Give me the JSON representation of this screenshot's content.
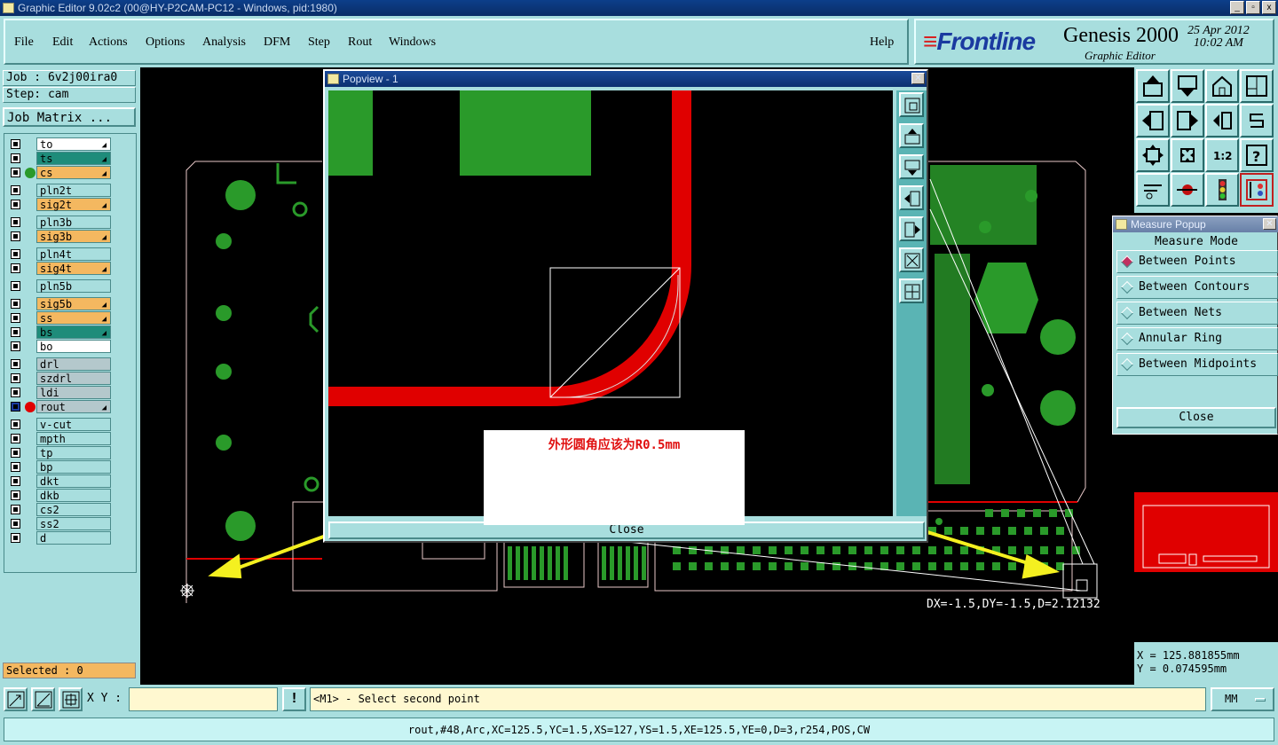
{
  "window": {
    "title": "Graphic Editor 9.02c2 (00@HY-P2CAM-PC12 - Windows, pid:1980)",
    "controls": [
      "_",
      "▫",
      "x"
    ]
  },
  "menu": {
    "items": [
      "File",
      "Edit",
      "Actions",
      "Options",
      "Analysis",
      "DFM",
      "Step",
      "Rout",
      "Windows"
    ],
    "help": "Help"
  },
  "brand": {
    "logo_prefix": "≡",
    "logo": "Frontline",
    "product": "Genesis 2000",
    "subtitle": "Graphic Editor",
    "date": "25 Apr 2012",
    "time": "10:02 AM"
  },
  "job": {
    "job_label": "Job : 6v2j00ira0",
    "step_label": "Step: cam",
    "matrix_button": "Job Matrix ..."
  },
  "layers": [
    {
      "name": "to",
      "color": "#ffffff",
      "pen": true
    },
    {
      "name": "ts",
      "color": "#1e8c7a",
      "pen": true
    },
    {
      "name": "cs",
      "color": "#f4b860",
      "pen": true,
      "dot": "#2a9a2a"
    },
    {
      "name": "pln2t",
      "color": "#a8dede"
    },
    {
      "name": "sig2t",
      "color": "#f4b860",
      "pen": true
    },
    {
      "name": "pln3b",
      "color": "#a8dede"
    },
    {
      "name": "sig3b",
      "color": "#f4b860",
      "pen": true
    },
    {
      "name": "pln4t",
      "color": "#a8dede"
    },
    {
      "name": "sig4t",
      "color": "#f4b860",
      "pen": true
    },
    {
      "name": "pln5b",
      "color": "#a8dede"
    },
    {
      "name": "sig5b",
      "color": "#f4b860",
      "pen": true
    },
    {
      "name": "ss",
      "color": "#f4b860",
      "pen": true
    },
    {
      "name": "bs",
      "color": "#1e8c7a",
      "pen": true
    },
    {
      "name": "bo",
      "color": "#ffffff"
    },
    {
      "name": "drl",
      "color": "#b4c8cc"
    },
    {
      "name": "szdrl",
      "color": "#b4c8cc"
    },
    {
      "name": "ldi",
      "color": "#b4c8cc"
    },
    {
      "name": "rout",
      "color": "#b4c8cc",
      "dot": "#e00000",
      "pen": true,
      "active": true
    },
    {
      "name": "v-cut",
      "color": "#a8dede"
    },
    {
      "name": "mpth",
      "color": "#a8dede"
    },
    {
      "name": "tp",
      "color": "#a8dede"
    },
    {
      "name": "bp",
      "color": "#a8dede"
    },
    {
      "name": "dkt",
      "color": "#a8dede"
    },
    {
      "name": "dkb",
      "color": "#a8dede"
    },
    {
      "name": "cs2",
      "color": "#a8dede"
    },
    {
      "name": "ss2",
      "color": "#a8dede"
    },
    {
      "name": "d",
      "color": "#a8dede"
    }
  ],
  "selected": "Selected : 0",
  "popview": {
    "title": "Popview - 1",
    "close": "Close"
  },
  "annotation": "外形圆角应该为R0.5mm",
  "measure_readout": "DX=-1.5,DY=-1.5,D=2.12132",
  "measure_popup": {
    "title": "Measure Popup",
    "mode_label": "Measure Mode",
    "options": [
      "Between Points",
      "Between Contours",
      "Between Nets",
      "Annular Ring",
      "Between Midpoints"
    ],
    "selected_index": 0,
    "close": "Close"
  },
  "coords": {
    "x": "X = 125.881855mm",
    "y": "Y = 0.074595mm"
  },
  "bottom": {
    "xy_label": "X Y :",
    "xy_value": "",
    "warn": "!",
    "prompt": "<M1> - Select second point",
    "units": "MM"
  },
  "status": "rout,#48,Arc,XC=125.5,YC=1.5,XS=127,YS=1.5,XE=125.5,YE=0,D=3,r254,POS,CW",
  "colors": {
    "panel": "#a8dede",
    "copper": "#2a9a2a",
    "rout": "#e00000",
    "arrow": "#f4f020"
  }
}
